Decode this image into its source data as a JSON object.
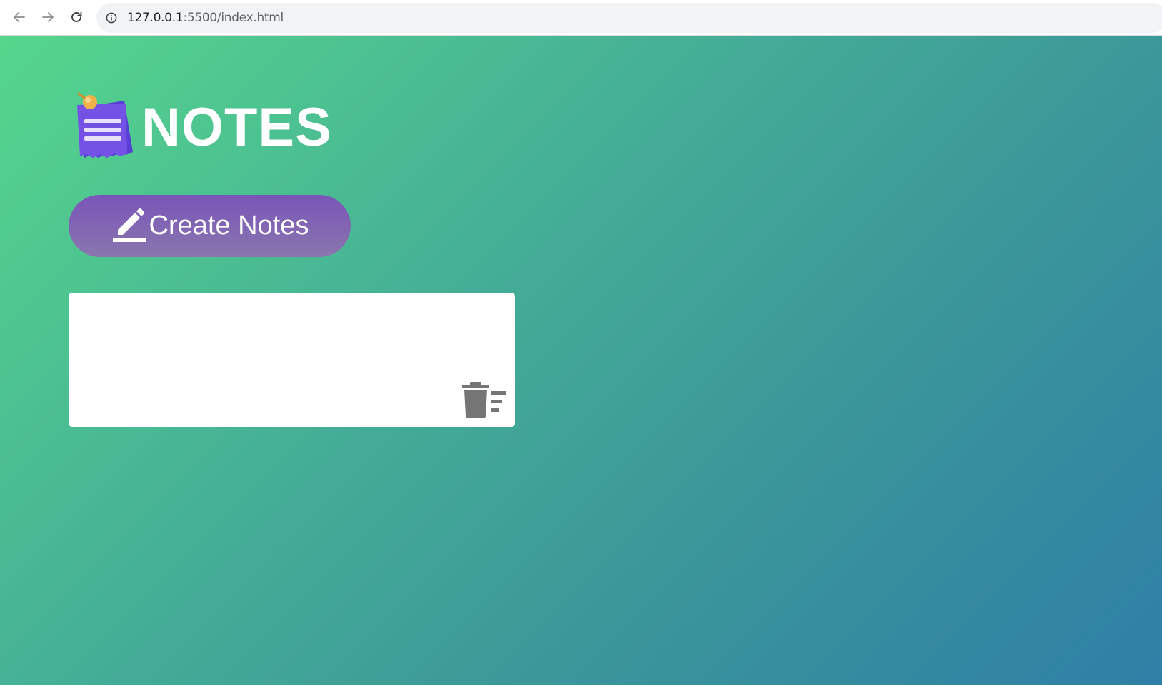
{
  "browser": {
    "url_host": "127.0.0.1",
    "url_path": ":5500/index.html",
    "icons": [
      "back-arrow-icon",
      "forward-arrow-icon",
      "reload-icon",
      "site-info-icon"
    ]
  },
  "app": {
    "title": "NOTES",
    "title_icon": "sticky-note-icon",
    "create_button_label": "Create Notes",
    "create_button_icon": "pencil-icon",
    "note": {
      "content": "",
      "delete_icon": "trash-icon"
    }
  },
  "colors": {
    "gradient_start": "#55d68c",
    "gradient_end": "#2e7fa6",
    "button_purple": "#7a55b9",
    "note_bg": "#ffffff",
    "trash_gray": "#757575"
  }
}
